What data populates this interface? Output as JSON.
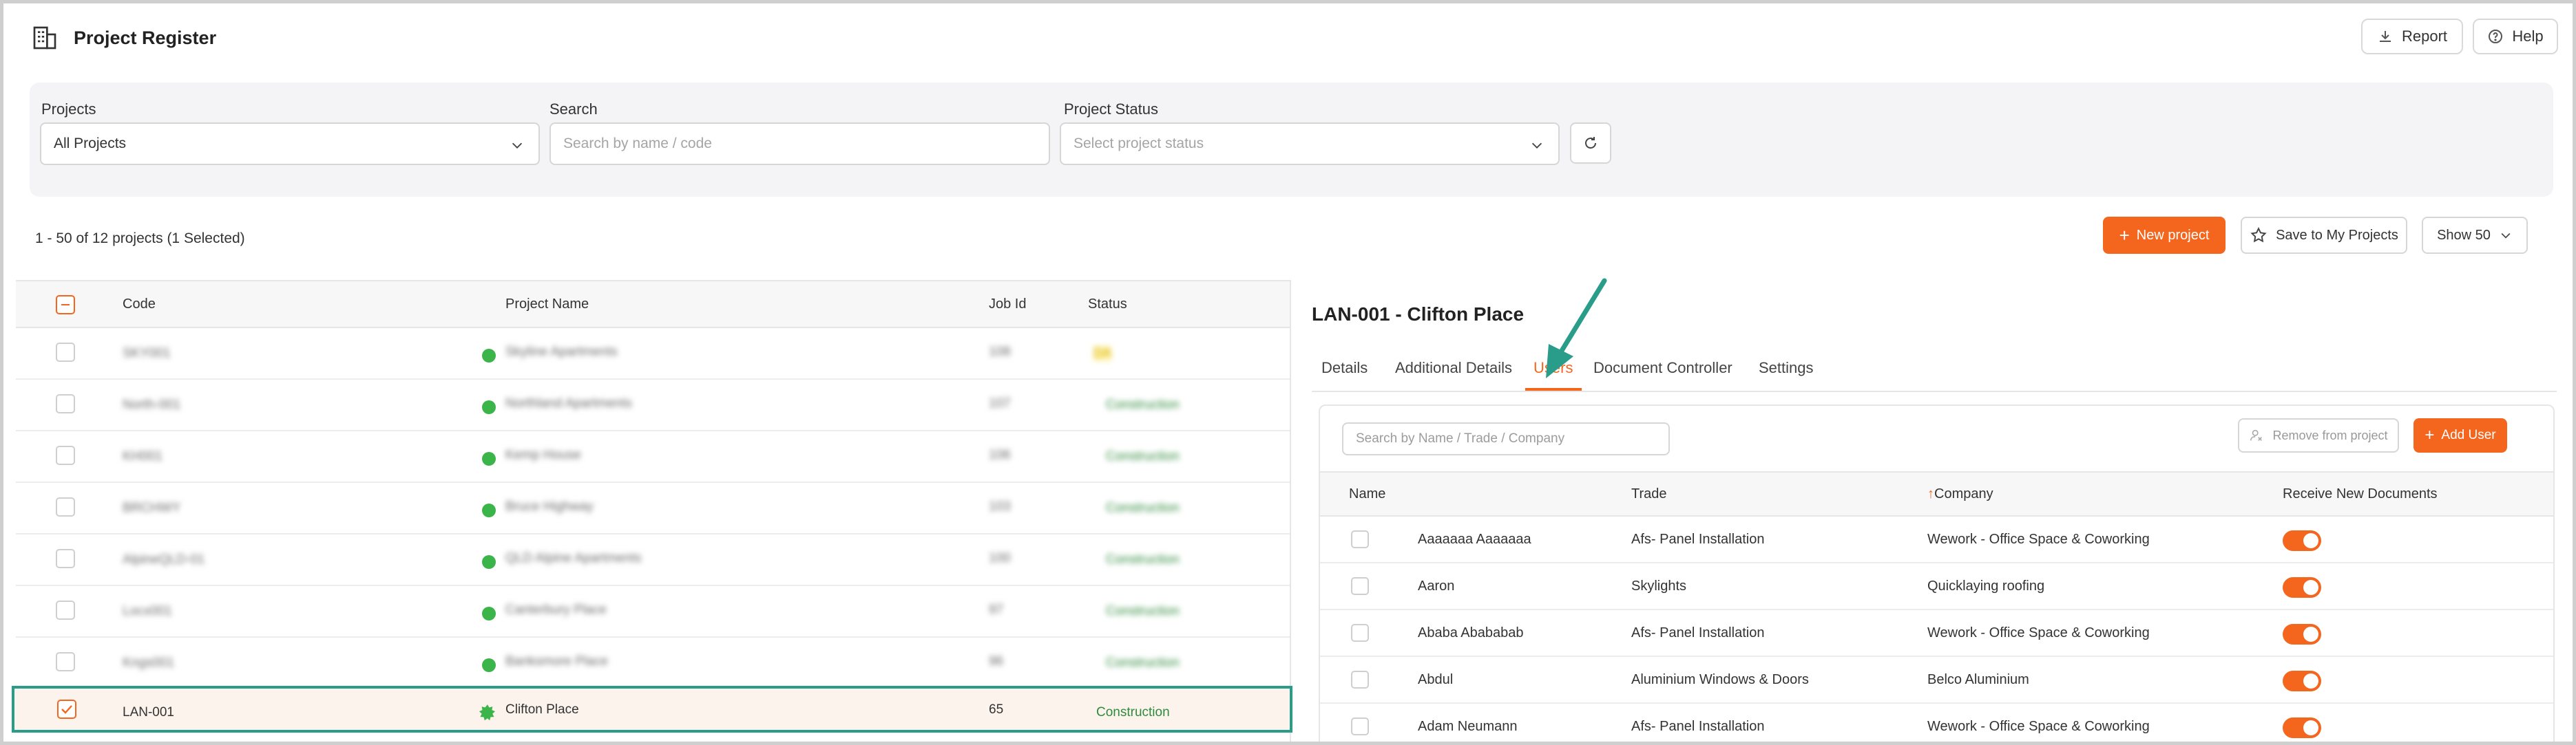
{
  "header": {
    "title": "Project Register",
    "report_label": "Report",
    "help_label": "Help"
  },
  "filters": {
    "projects_label": "Projects",
    "projects_value": "All Projects",
    "search_label": "Search",
    "search_placeholder": "Search by name / code",
    "status_label": "Project Status",
    "status_placeholder": "Select project status"
  },
  "toolbar": {
    "count_text": "1 - 50 of 12 projects (1 Selected)",
    "new_project_label": "New project",
    "save_label": "Save to My Projects",
    "show_label": "Show 50"
  },
  "projects_table": {
    "columns": [
      "Code",
      "Project Name",
      "Job Id",
      "Status"
    ],
    "rows": [
      {
        "code": "SKY001",
        "name": "Skyline Apartments",
        "job": "108",
        "status": "DA"
      },
      {
        "code": "North-001",
        "name": "Northland Apartments",
        "job": "107",
        "status": "Construction"
      },
      {
        "code": "KH001",
        "name": "Kemp House",
        "job": "106",
        "status": "Construction"
      },
      {
        "code": "BRCHWY",
        "name": "Bruce Highway",
        "job": "103",
        "status": "Construction"
      },
      {
        "code": "AlpineQLD-01",
        "name": "QLD Alpine Apartments",
        "job": "100",
        "status": "Construction"
      },
      {
        "code": "Locx001",
        "name": "Canterbury Place",
        "job": "97",
        "status": "Construction"
      },
      {
        "code": "Kngs001",
        "name": "Banksmore Place",
        "job": "96",
        "status": "Construction"
      },
      {
        "code": "LAN-001",
        "name": "Clifton Place",
        "job": "65",
        "status": "Construction"
      }
    ]
  },
  "detail": {
    "title": "LAN-001 - Clifton Place",
    "tabs": [
      "Details",
      "Additional Details",
      "Users",
      "Document Controller",
      "Settings"
    ],
    "users": {
      "search_placeholder": "Search by Name / Trade / Company",
      "remove_label": "Remove from project",
      "add_label": "Add User",
      "columns": [
        "Name",
        "Trade",
        "Company",
        "Receive New Documents"
      ],
      "sort_arrow": "↑",
      "rows": [
        {
          "name": "Aaaaaaa Aaaaaaa",
          "trade": "Afs- Panel Installation",
          "company": "Wework - Office Space & Coworking"
        },
        {
          "name": "Aaron",
          "trade": "Skylights",
          "company": "Quicklaying roofing"
        },
        {
          "name": "Ababa Abababab",
          "trade": "Afs- Panel Installation",
          "company": "Wework - Office Space & Coworking"
        },
        {
          "name": "Abdul",
          "trade": "Aluminium Windows & Doors",
          "company": "Belco Aluminium"
        },
        {
          "name": "Adam Neumann",
          "trade": "Afs- Panel Installation",
          "company": "Wework - Office Space & Coworking"
        }
      ]
    }
  },
  "colors": {
    "accent": "#f4661e",
    "highlight": "#2a9d8a",
    "status_green": "#2e8b3c"
  }
}
